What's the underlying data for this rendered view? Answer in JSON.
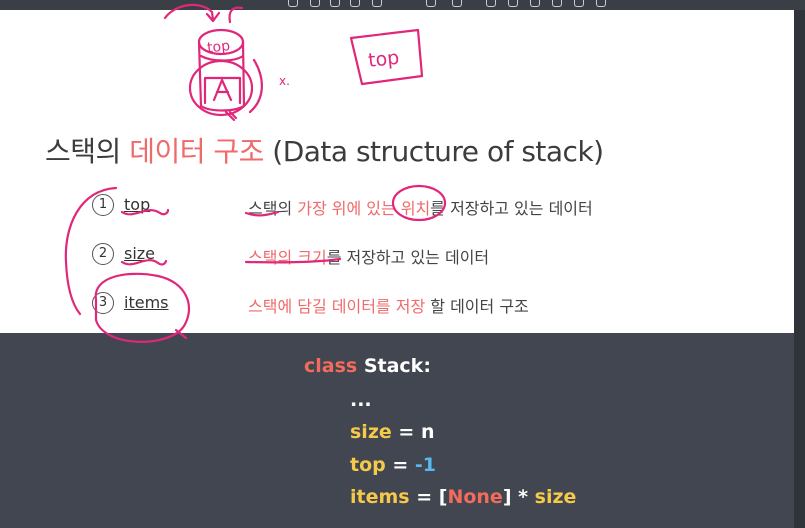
{
  "slide": {
    "title_part1": "스택의 ",
    "title_accent": "데이터 구조",
    "title_part2": " (Data structure of stack)",
    "rows": [
      {
        "number": "1",
        "term": "top",
        "desc_plain_a": "스택의 ",
        "desc_pink": "가장 위에 있는 위치",
        "desc_plain_b": "를 저장하고 있는 데이터"
      },
      {
        "number": "2",
        "term": "size",
        "desc_pink": "스택의 크기",
        "desc_plain_b": "를 저장하고 있는 데이터"
      },
      {
        "number": "3",
        "term": "items",
        "desc_pink": "스택에 담길 데이터를 저장",
        "desc_plain_b": " 할 데이터 구조"
      }
    ]
  },
  "code": {
    "l1_keyword": "class",
    "l1_rest": " Stack:",
    "l2": "...",
    "l3_name": "size",
    "l3_eq": " = ",
    "l3_val": "n",
    "l4_name": "top",
    "l4_eq": " = ",
    "l4_val": "-1",
    "l5_name": "items",
    "l5_eq": " = [",
    "l5_none": "None",
    "l5_rest": "] * ",
    "l5_size": "size"
  },
  "annotations": {
    "drawing_top_label": "top",
    "boxed_label": "top",
    "x_mark": "x."
  },
  "colors": {
    "accent": "#ef6a6a",
    "ink": "#e0287a",
    "code_bg": "#414650",
    "code_keyword": "#f36b5c",
    "code_name": "#f5c94a",
    "code_number": "#5ab8f0"
  }
}
